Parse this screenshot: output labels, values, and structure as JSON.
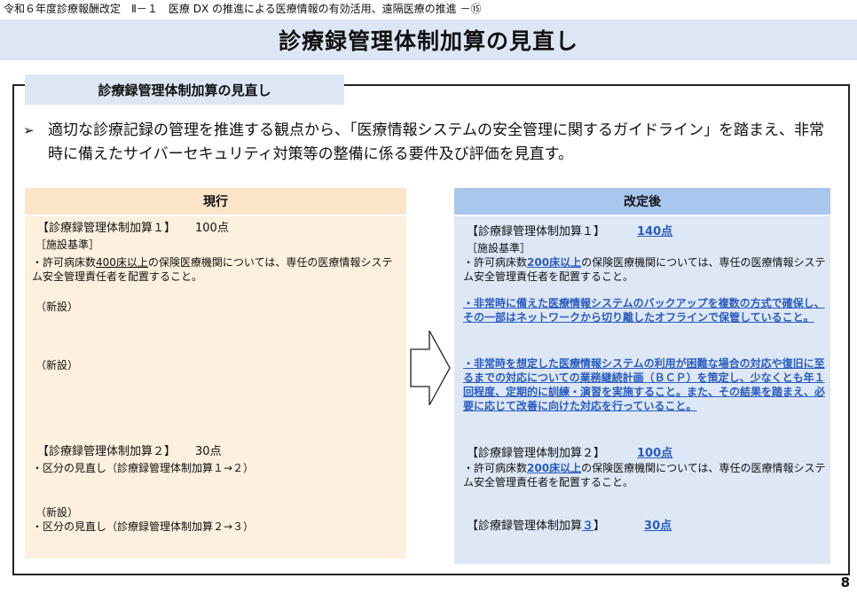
{
  "breadcrumb": "令和６年度診療報酬改定　Ⅱ－１　医療 DX の推進による医療情報の有効活用、遠隔医療の推進 －⑮",
  "title": "診療録管理体制加算の見直し",
  "section_tab": "診療録管理体制加算の見直し",
  "lead": {
    "marker": "➢",
    "text": "適切な診療記録の管理を推進する観点から、「医療情報システムの安全管理に関するガイドライン」を踏まえ、非常時に備えたサイバーセキュリティ対策等の整備に係る要件及び評価を見直す。"
  },
  "current": {
    "heading": "現行",
    "item1_label": "【診療録管理体制加算１】",
    "item1_score": "100点",
    "facility": "［施設基準］",
    "req_prefix": "・許可病床数",
    "req_highlight": "400床以上",
    "req_rest": "の保険医療機関については、専任の医療情報システム安全管理責任者を配置すること。",
    "new1": "（新設）",
    "new2": "（新設）",
    "item2_label": "【診療録管理体制加算２】",
    "item2_score": "30点",
    "item2_note": "・区分の見直し（診療録管理体制加算１→２）",
    "new3": "（新設）",
    "item3_note": "・区分の見直し（診療録管理体制加算２→３）"
  },
  "revised": {
    "heading": "改定後",
    "item1_label": "【診療録管理体制加算１】",
    "item1_score": "140点",
    "facility": "［施設基準］",
    "req_prefix": "・許可病床数",
    "req_highlight": "200床以上",
    "req_rest": "の保険医療機関については、専任の医療情報システム安全管理責任者を配置すること。",
    "backup": "・非常時に備えた医療情報システムのバックアップを複数の方式で確保し、その一部はネットワークから切り離したオフラインで保管していること。",
    "bcp": "・非常時を想定した医療情報システムの利用が困難な場合の対応や復旧に至るまでの対応についての業務継続計画（ＢＣＰ）を策定し、少なくとも年１回程度、定期的に訓練・演習を実施すること。また、その結果を踏まえ、必要に応じて改善に向けた対応を行っていること。",
    "item2_label": "【診療録管理体制加算２】",
    "item2_score": "100点",
    "req2_prefix": "・許可病床数",
    "req2_highlight": "200床以上",
    "req2_rest": "の保険医療機関については、専任の医療情報システム安全管理責任者を配置すること。",
    "item3_label_prefix": "【診療録管理体制加算",
    "item3_label_num": "３",
    "item3_label_suffix": "】",
    "item3_score": "30点"
  },
  "page_number": "8"
}
